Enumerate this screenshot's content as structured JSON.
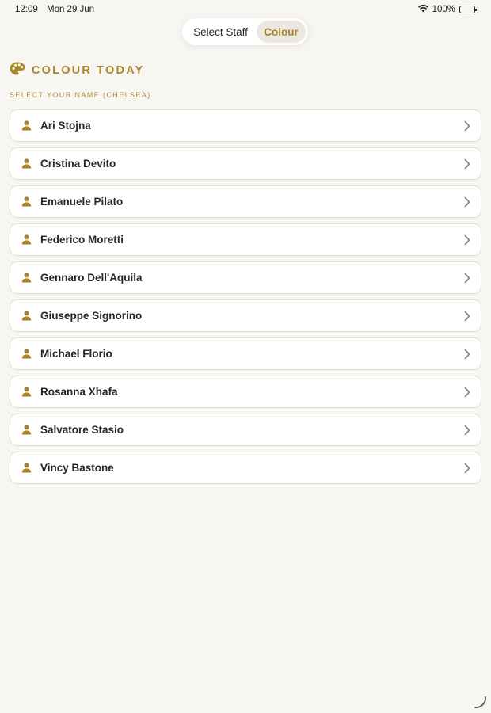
{
  "status": {
    "time": "12:09",
    "date": "Mon 29 Jun",
    "battery": "100%"
  },
  "segmented": {
    "options": [
      "Select Staff",
      "Colour"
    ],
    "selected": "Colour"
  },
  "heading": {
    "icon": "palette-icon",
    "title": "COLOUR TODAY"
  },
  "subheading": "SELECT YOUR NAME (CHELSEA)",
  "staff": [
    {
      "name": "Ari Stojna"
    },
    {
      "name": "Cristina Devito"
    },
    {
      "name": "Emanuele Pilato"
    },
    {
      "name": "Federico Moretti"
    },
    {
      "name": "Gennaro Dell'Aquila"
    },
    {
      "name": "Giuseppe Signorino"
    },
    {
      "name": "Michael Florio"
    },
    {
      "name": "Rosanna Xhafa"
    },
    {
      "name": "Salvatore Stasio"
    },
    {
      "name": "Vincy Bastone"
    }
  ],
  "colors": {
    "accent": "#a8852a",
    "background": "#f8f6f2",
    "card": "#ffffff"
  }
}
